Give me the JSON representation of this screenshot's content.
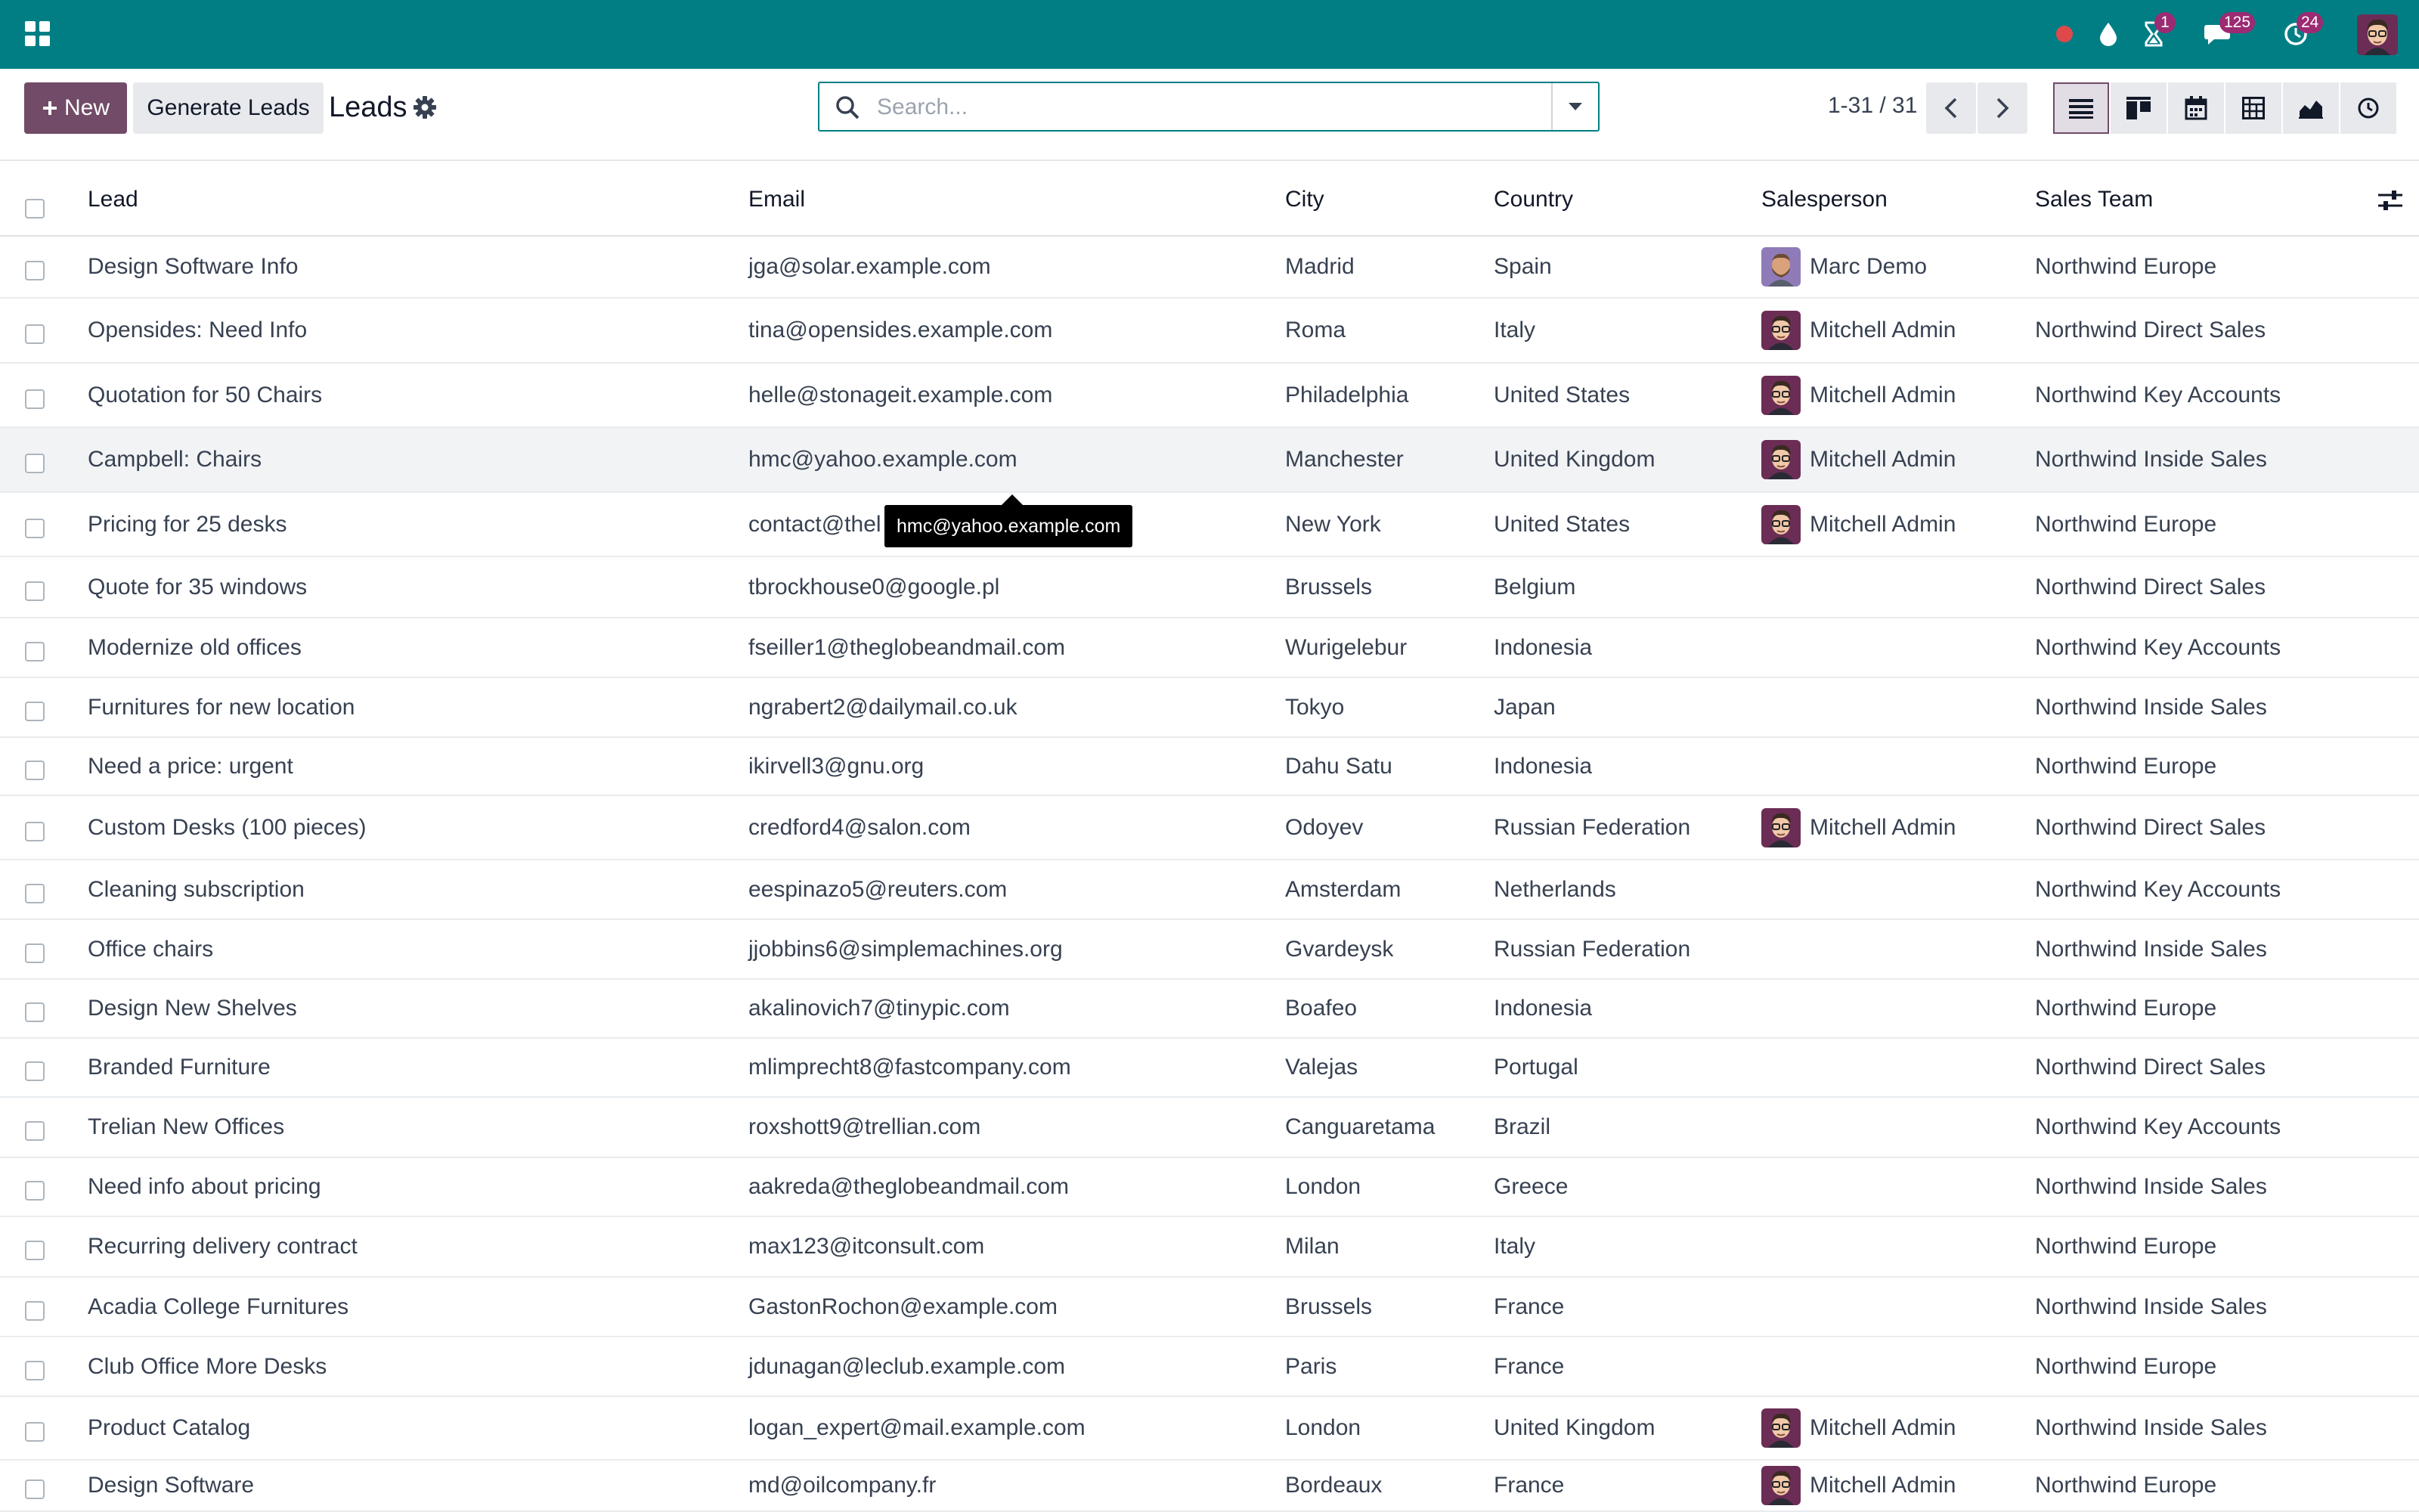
{
  "navbar": {
    "badges": {
      "activities": "1",
      "messages": "125",
      "updates": "24"
    },
    "color": "#017e84"
  },
  "control_panel": {
    "new_label": "New",
    "generate_label": "Generate Leads",
    "breadcrumb": "Leads",
    "search_placeholder": "Search...",
    "pager": "1-31 / 31"
  },
  "columns": {
    "lead": "Lead",
    "email": "Email",
    "city": "City",
    "country": "Country",
    "salesperson": "Salesperson",
    "team": "Sales Team"
  },
  "tooltip": "hmc@yahoo.example.com",
  "rows": [
    {
      "lead": "Design Software Info",
      "email": "jga@solar.example.com",
      "city": "Madrid",
      "country": "Spain",
      "salesperson": "Marc Demo",
      "avatar": "marc",
      "team": "Northwind Europe"
    },
    {
      "lead": "Opensides: Need Info",
      "email": "tina@opensides.example.com",
      "city": "Roma",
      "country": "Italy",
      "salesperson": "Mitchell Admin",
      "avatar": "mitchell",
      "team": "Northwind Direct Sales"
    },
    {
      "lead": "Quotation for 50 Chairs",
      "email": "helle@stonageit.example.com",
      "city": "Philadelphia",
      "country": "United States",
      "salesperson": "Mitchell Admin",
      "avatar": "mitchell",
      "team": "Northwind Key Accounts"
    },
    {
      "lead": "Campbell: Chairs",
      "email": "hmc@yahoo.example.com",
      "city": "Manchester",
      "country": "United Kingdom",
      "salesperson": "Mitchell Admin",
      "avatar": "mitchell",
      "team": "Northwind Inside Sales"
    },
    {
      "lead": "Pricing for 25 desks",
      "email": "contact@thel",
      "city": "New York",
      "country": "United States",
      "salesperson": "Mitchell Admin",
      "avatar": "mitchell",
      "team": "Northwind Europe"
    },
    {
      "lead": "Quote for 35 windows",
      "email": "tbrockhouse0@google.pl",
      "city": "Brussels",
      "country": "Belgium",
      "salesperson": "",
      "avatar": "",
      "team": "Northwind Direct Sales"
    },
    {
      "lead": "Modernize old offices",
      "email": "fseiller1@theglobeandmail.com",
      "city": "Wurigelebur",
      "country": "Indonesia",
      "salesperson": "",
      "avatar": "",
      "team": "Northwind Key Accounts"
    },
    {
      "lead": "Furnitures for new location",
      "email": "ngrabert2@dailymail.co.uk",
      "city": "Tokyo",
      "country": "Japan",
      "salesperson": "",
      "avatar": "",
      "team": "Northwind Inside Sales"
    },
    {
      "lead": "Need a price: urgent",
      "email": "ikirvell3@gnu.org",
      "city": "Dahu Satu",
      "country": "Indonesia",
      "salesperson": "",
      "avatar": "",
      "team": "Northwind Europe"
    },
    {
      "lead": "Custom Desks (100 pieces)",
      "email": "credford4@salon.com",
      "city": "Odoyev",
      "country": "Russian Federation",
      "salesperson": "Mitchell Admin",
      "avatar": "mitchell",
      "team": "Northwind Direct Sales"
    },
    {
      "lead": "Cleaning subscription",
      "email": "eespinazo5@reuters.com",
      "city": "Amsterdam",
      "country": "Netherlands",
      "salesperson": "",
      "avatar": "",
      "team": "Northwind Key Accounts"
    },
    {
      "lead": "Office chairs",
      "email": "jjobbins6@simplemachines.org",
      "city": "Gvardeysk",
      "country": "Russian Federation",
      "salesperson": "",
      "avatar": "",
      "team": "Northwind Inside Sales"
    },
    {
      "lead": "Design New Shelves",
      "email": "akalinovich7@tinypic.com",
      "city": "Boafeo",
      "country": "Indonesia",
      "salesperson": "",
      "avatar": "",
      "team": "Northwind Europe"
    },
    {
      "lead": "Branded Furniture",
      "email": "mlimprecht8@fastcompany.com",
      "city": "Valejas",
      "country": "Portugal",
      "salesperson": "",
      "avatar": "",
      "team": "Northwind Direct Sales"
    },
    {
      "lead": "Trelian New Offices",
      "email": "roxshott9@trellian.com",
      "city": "Canguaretama",
      "country": "Brazil",
      "salesperson": "",
      "avatar": "",
      "team": "Northwind Key Accounts"
    },
    {
      "lead": "Need info about pricing",
      "email": "aakreda@theglobeandmail.com",
      "city": "London",
      "country": "Greece",
      "salesperson": "",
      "avatar": "",
      "team": "Northwind Inside Sales"
    },
    {
      "lead": "Recurring delivery contract",
      "email": "max123@itconsult.com",
      "city": "Milan",
      "country": "Italy",
      "salesperson": "",
      "avatar": "",
      "team": "Northwind Europe"
    },
    {
      "lead": "Acadia College Furnitures",
      "email": "GastonRochon@example.com",
      "city": "Brussels",
      "country": "France",
      "salesperson": "",
      "avatar": "",
      "team": "Northwind Inside Sales"
    },
    {
      "lead": "Club Office More Desks",
      "email": "jdunagan@leclub.example.com",
      "city": "Paris",
      "country": "France",
      "salesperson": "",
      "avatar": "",
      "team": "Northwind Europe"
    },
    {
      "lead": "Product Catalog",
      "email": "logan_expert@mail.example.com",
      "city": "London",
      "country": "United Kingdom",
      "salesperson": "Mitchell Admin",
      "avatar": "mitchell",
      "team": "Northwind Inside Sales"
    },
    {
      "lead": "Design Software",
      "email": "md@oilcompany.fr",
      "city": "Bordeaux",
      "country": "France",
      "salesperson": "Mitchell Admin",
      "avatar": "mitchell",
      "team": "Northwind Europe"
    }
  ]
}
